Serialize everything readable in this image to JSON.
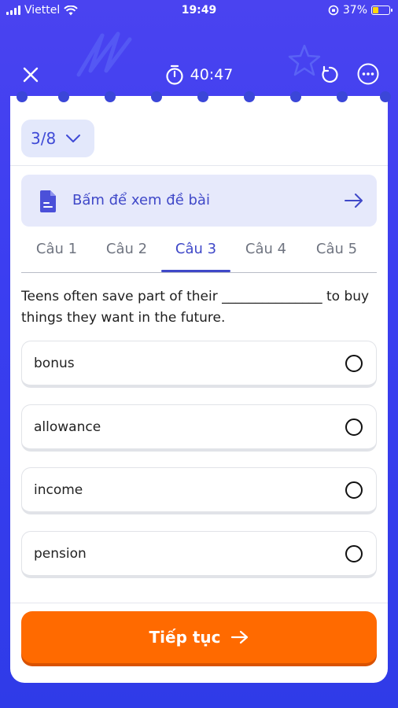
{
  "status_bar": {
    "carrier": "Viettel",
    "time": "19:49",
    "battery": "37%",
    "battery_level": 0.37
  },
  "top_bar": {
    "timer": "40:47",
    "icons": [
      "close-icon",
      "stopwatch-icon",
      "reset-icon",
      "more-icon"
    ]
  },
  "progress": {
    "label": "3/8"
  },
  "view_task": {
    "label": "Bấm để xem đề bài"
  },
  "tabs": [
    {
      "label": "Câu 1",
      "active": false
    },
    {
      "label": "Câu 2",
      "active": false
    },
    {
      "label": "Câu 3",
      "active": true
    },
    {
      "label": "Câu 4",
      "active": false
    },
    {
      "label": "Câu 5",
      "active": false
    }
  ],
  "question": {
    "text": "Teens often save part of their _______________ to buy things they want in the future."
  },
  "options": [
    {
      "label": "bonus",
      "selected": false
    },
    {
      "label": "allowance",
      "selected": false
    },
    {
      "label": "income",
      "selected": false
    },
    {
      "label": "pension",
      "selected": false
    }
  ],
  "footer": {
    "continue_label": "Tiếp tục"
  },
  "colors": {
    "background": "#3b3ef0",
    "accent": "#3f48c8",
    "button": "#ff6a00"
  }
}
